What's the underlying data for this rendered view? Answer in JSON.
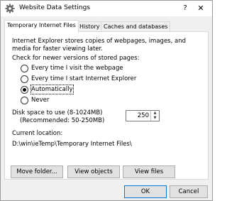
{
  "window": {
    "title": "Website Data Settings",
    "help_glyph": "?",
    "close_glyph": "✕"
  },
  "tabs": [
    {
      "label": "Temporary Internet Files",
      "active": true
    },
    {
      "label": "History",
      "active": false
    },
    {
      "label": "Caches and databases",
      "active": false
    }
  ],
  "temp_files": {
    "description": "Internet Explorer stores copies of webpages, images, and media for faster viewing later.",
    "check_label": "Check for newer versions of stored pages:",
    "options": [
      {
        "label": "Every time I visit the webpage",
        "checked": false
      },
      {
        "label": "Every time I start Internet Explorer",
        "checked": false
      },
      {
        "label": "Automatically",
        "checked": true
      },
      {
        "label": "Never",
        "checked": false
      }
    ],
    "disk_label_line1": "Disk space to use (8-1024MB)",
    "disk_label_line2": "(Recommended: 50-250MB)",
    "disk_value": "250",
    "location_label": "Current location:",
    "location_value": "D:\\win\\ieTemp\\Temporary Internet Files\\",
    "buttons": {
      "move": "Move folder...",
      "view_objects": "View objects",
      "view_files": "View files"
    }
  },
  "footer": {
    "ok": "OK",
    "cancel": "Cancel"
  },
  "colors": {
    "accent": "#0078d7"
  },
  "icons": {
    "title": "settings-gear-icon"
  }
}
